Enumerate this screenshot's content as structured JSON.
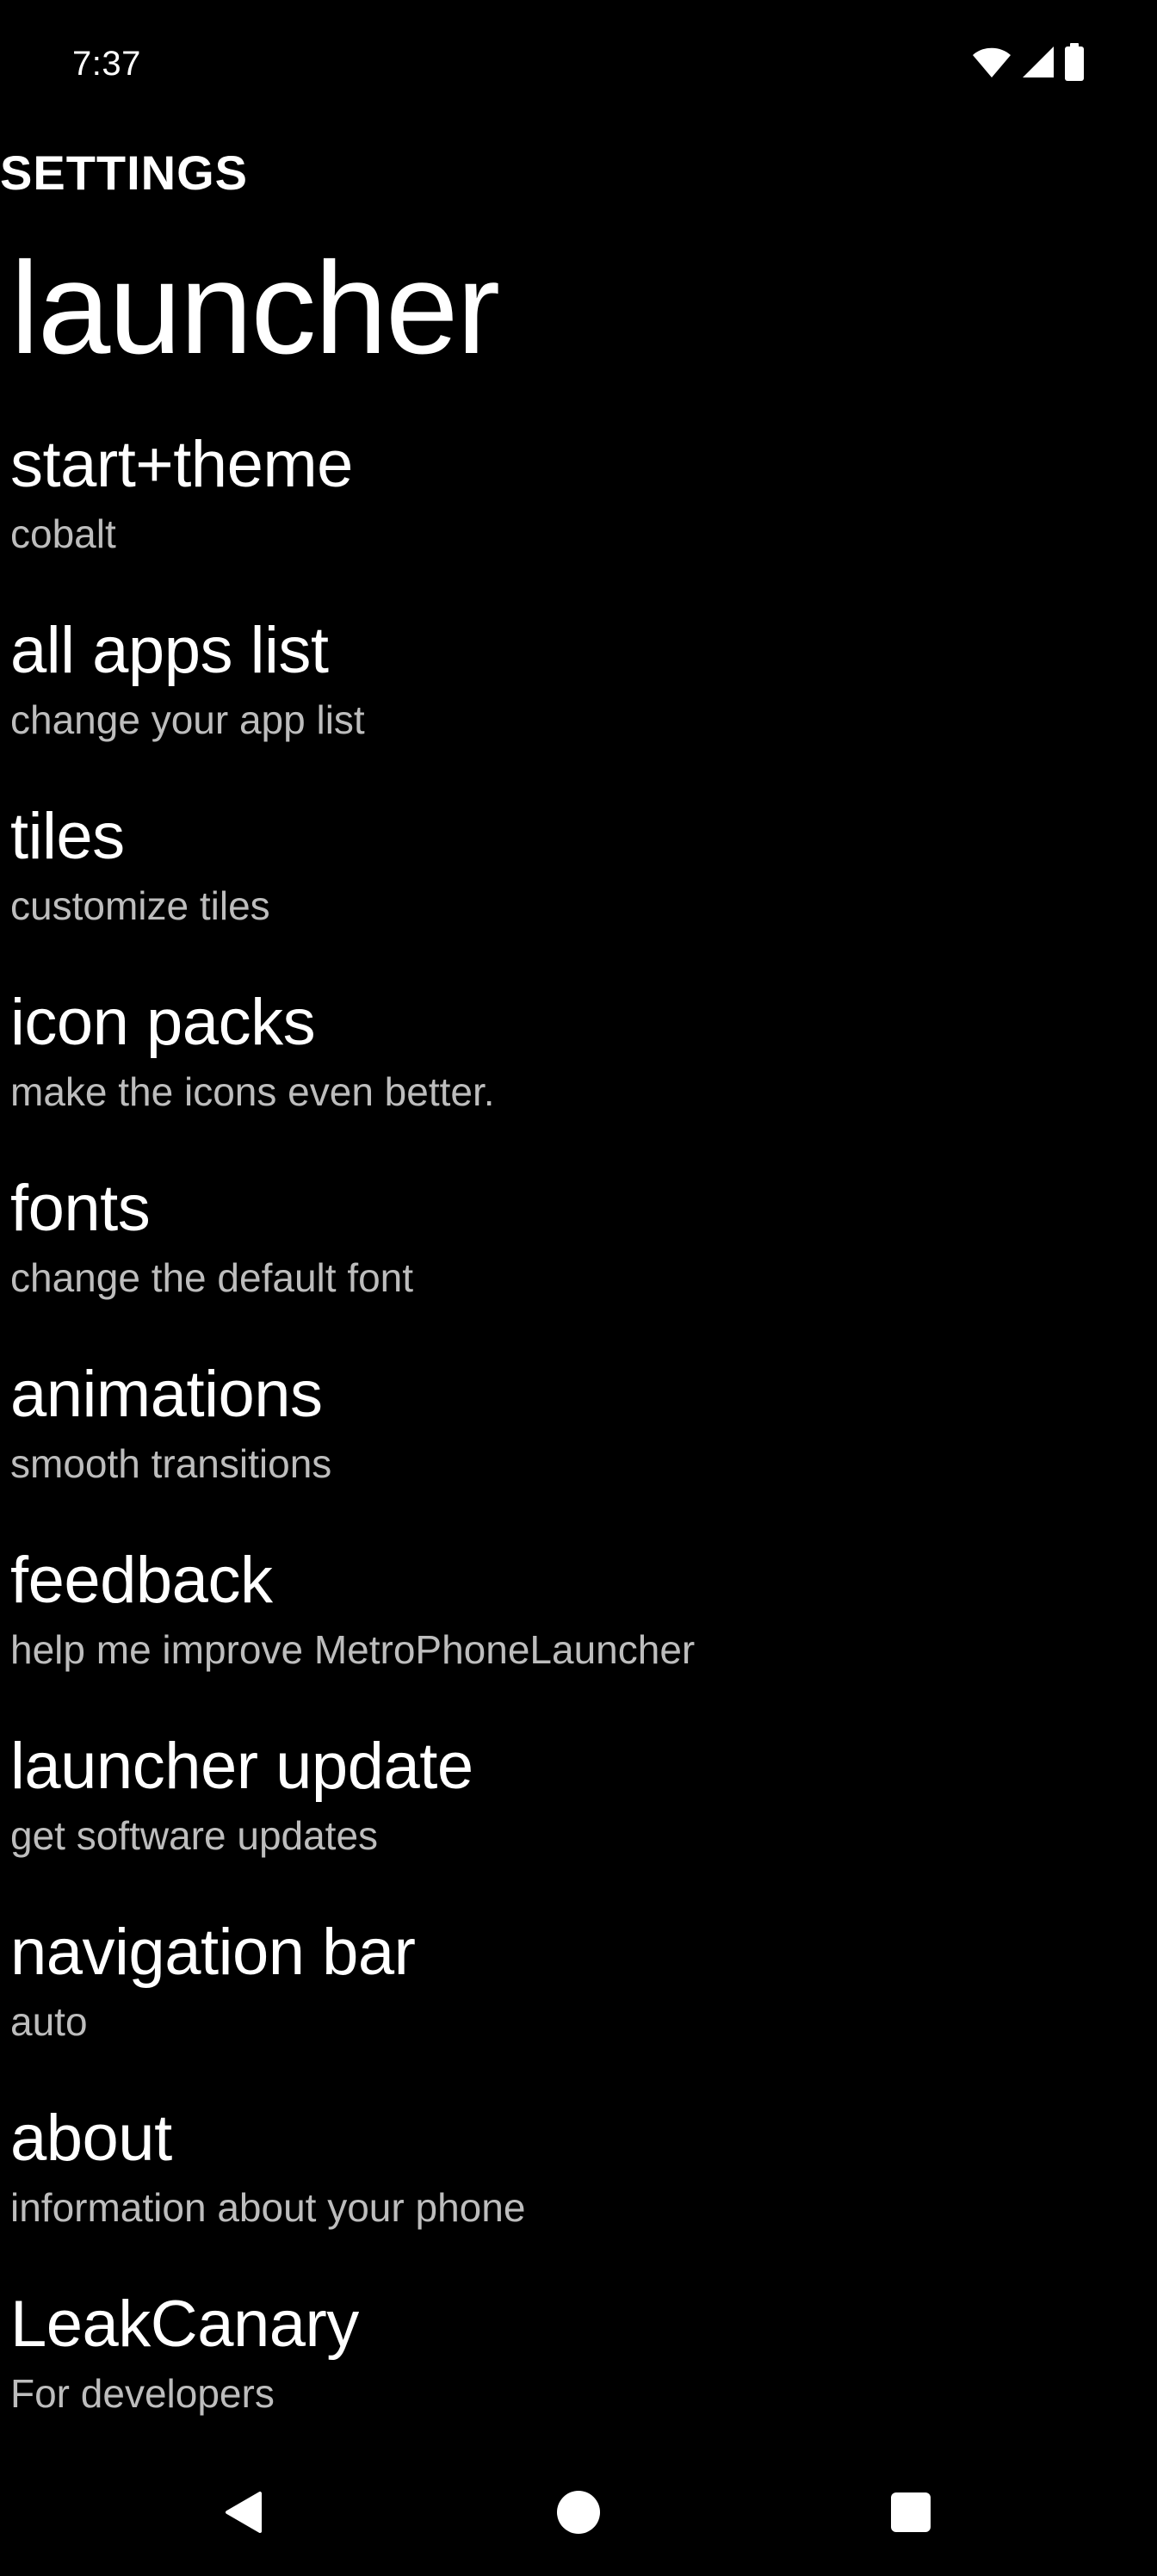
{
  "status_bar": {
    "time": "7:37",
    "icons": [
      "wifi-icon",
      "cellular-signal-icon",
      "battery-icon"
    ]
  },
  "header": {
    "section_label": "SETTINGS",
    "title": "launcher"
  },
  "settings": {
    "items": [
      {
        "title": "start+theme",
        "subtitle": "cobalt"
      },
      {
        "title": "all apps list",
        "subtitle": "change your app list"
      },
      {
        "title": "tiles",
        "subtitle": "customize tiles"
      },
      {
        "title": "icon packs",
        "subtitle": "make the icons even better."
      },
      {
        "title": "fonts",
        "subtitle": "change the default font"
      },
      {
        "title": "animations",
        "subtitle": "smooth transitions"
      },
      {
        "title": "feedback",
        "subtitle": "help me improve MetroPhoneLauncher"
      },
      {
        "title": "launcher update",
        "subtitle": "get software updates"
      },
      {
        "title": "navigation bar",
        "subtitle": "auto"
      },
      {
        "title": "about",
        "subtitle": "information about your phone"
      },
      {
        "title": "LeakCanary",
        "subtitle": "For developers"
      }
    ]
  },
  "nav_bar": {
    "icons": [
      "back-icon",
      "home-icon",
      "recents-icon"
    ]
  },
  "colors": {
    "background": "#000000",
    "text_primary": "#ffffff",
    "text_secondary": "#bdbdbd"
  }
}
